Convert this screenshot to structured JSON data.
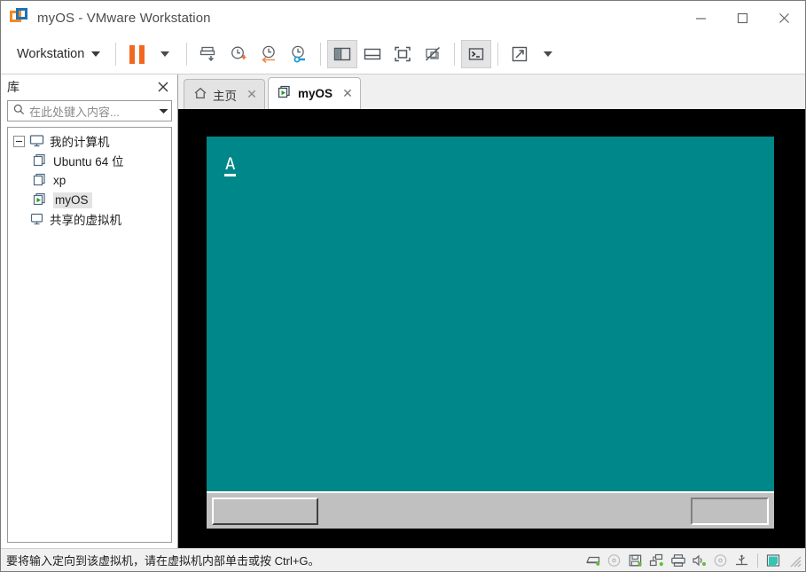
{
  "window": {
    "title": "myOS - VMware Workstation",
    "app_icon": "vmware-logo-icon",
    "minimize_label": "—",
    "maximize_label": "□",
    "close_label": "✕"
  },
  "toolbar": {
    "menu_label": "Workstation",
    "menu_caret": "chevron-down-icon",
    "buttons": [
      {
        "name": "suspend-button",
        "icon": "pause-icon"
      },
      {
        "name": "power-dropdown",
        "icon": "chevron-down-icon"
      },
      {
        "name": "manage-snapshot-button",
        "icon": "snapshot-icon"
      },
      {
        "name": "take-snapshot-button",
        "icon": "clock-plus-icon"
      },
      {
        "name": "revert-snapshot-button",
        "icon": "clock-back-icon"
      },
      {
        "name": "snapshot-manager-button",
        "icon": "clock-wrench-icon"
      },
      {
        "name": "show-library-button",
        "icon": "left-panel-icon"
      },
      {
        "name": "show-thumbnail-bar-button",
        "icon": "bottom-panel-icon"
      },
      {
        "name": "full-screen-button",
        "icon": "fullscreen-icon"
      },
      {
        "name": "unity-mode-button",
        "icon": "unity-disabled-icon"
      },
      {
        "name": "console-view-button",
        "icon": "console-icon"
      },
      {
        "name": "stretch-guest-button",
        "icon": "expand-arrows-icon"
      },
      {
        "name": "stretch-dropdown",
        "icon": "chevron-down-icon"
      }
    ]
  },
  "sidebar": {
    "header_title": "库",
    "close_icon": "close-icon",
    "search": {
      "icon": "search-icon",
      "placeholder": "在此处键入内容...",
      "value": "",
      "dropdown_icon": "chevron-down-icon"
    },
    "tree": [
      {
        "label": "我的计算机",
        "icon": "computer-icon",
        "expanded": true,
        "toggle": "collapse-icon",
        "children": [
          {
            "label": "Ubuntu 64 位",
            "icon": "vm-icon",
            "running": false,
            "selected": false
          },
          {
            "label": "xp",
            "icon": "vm-icon",
            "running": false,
            "selected": false
          },
          {
            "label": "myOS",
            "icon": "vm-running-icon",
            "running": true,
            "selected": true
          }
        ]
      },
      {
        "label": "共享的虚拟机",
        "icon": "shared-vm-icon",
        "expanded": false,
        "children": []
      }
    ]
  },
  "tabs": [
    {
      "label": "主页",
      "icon": "home-icon",
      "active": false,
      "close_icon": "✕"
    },
    {
      "label": "myOS",
      "icon": "vm-running-icon",
      "active": true,
      "close_icon": "✕"
    }
  ],
  "vm": {
    "screen_bg": "#008789",
    "stage_bg": "#000000",
    "console_text": "A",
    "cursor": "block-cursor",
    "taskbar": {
      "start_button_label": "",
      "tray_label": ""
    }
  },
  "statusbar": {
    "message": "要将输入定向到该虚拟机，请在虚拟机内部单击或按 Ctrl+G。",
    "devices": [
      {
        "name": "hard-disk-icon"
      },
      {
        "name": "cd-dvd-icon"
      },
      {
        "name": "floppy-icon"
      },
      {
        "name": "network-adapter-icon"
      },
      {
        "name": "printer-icon"
      },
      {
        "name": "sound-card-icon"
      },
      {
        "name": "optical-drive-icon"
      },
      {
        "name": "usb-icon"
      }
    ],
    "message_icon": "notes-icon",
    "resize_grip": "resize-grip-icon"
  },
  "colors": {
    "accent_orange": "#f2671f",
    "vm_teal": "#008789",
    "vm_taskbar_gray": "#c0c0c0",
    "chrome_bg": "#ffffff"
  }
}
